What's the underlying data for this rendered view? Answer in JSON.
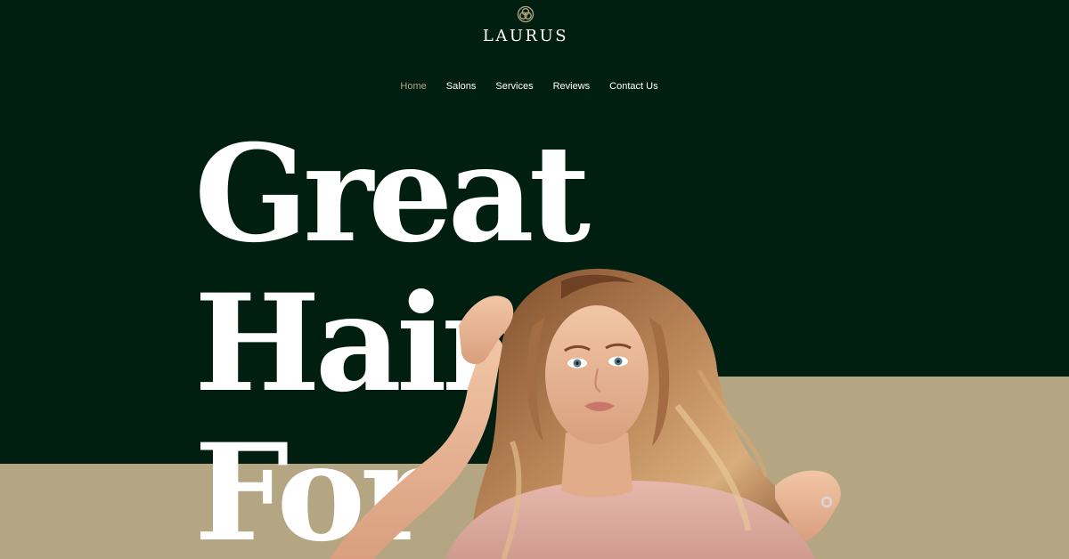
{
  "brand": {
    "name": "LAURUS",
    "logo_icon": "flower-knot-icon",
    "accent_color": "#b4a682",
    "dark_color": "#011f11"
  },
  "nav": {
    "items": [
      {
        "label": "Home",
        "active": true
      },
      {
        "label": "Salons",
        "active": false
      },
      {
        "label": "Services",
        "active": false
      },
      {
        "label": "Reviews",
        "active": false
      },
      {
        "label": "Contact Us",
        "active": false
      }
    ]
  },
  "hero": {
    "line1": "Great",
    "line2": "Hair",
    "line3": "For All"
  }
}
